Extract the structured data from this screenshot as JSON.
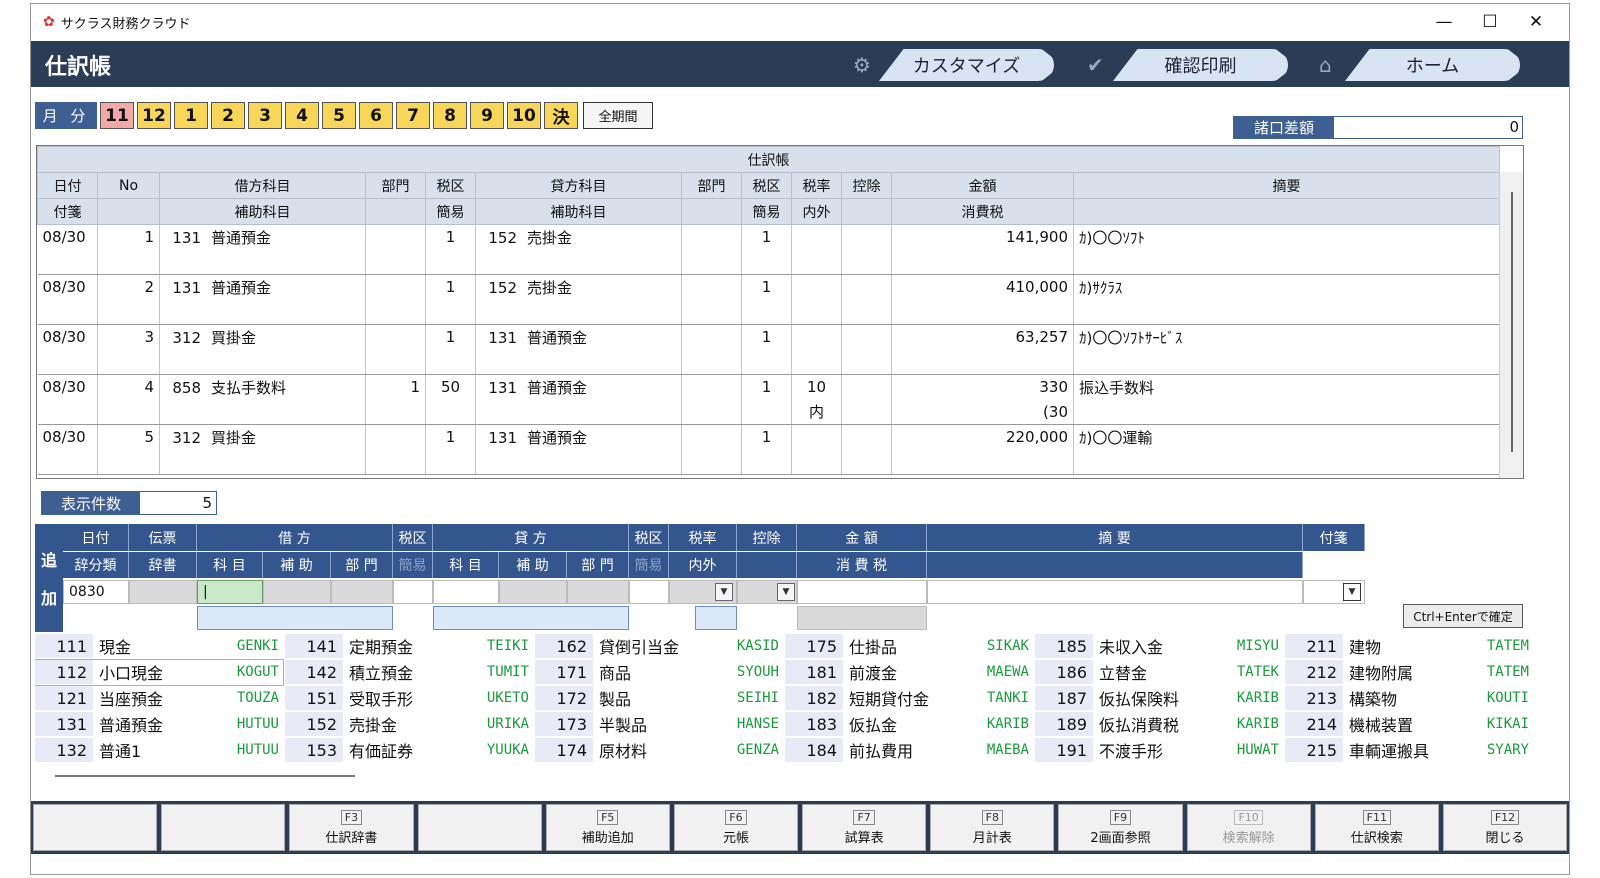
{
  "window": {
    "title": "サクラス財務クラウド",
    "min": "—",
    "max": "☐",
    "close": "✕"
  },
  "header": {
    "page_title": "仕訳帳",
    "btn_customize": "カスタマイズ",
    "btn_confirm_print": "確認印刷",
    "btn_home": "ホーム"
  },
  "months": {
    "label": "月 分",
    "items": [
      "11",
      "12",
      "1",
      "2",
      "3",
      "4",
      "5",
      "6",
      "7",
      "8",
      "9",
      "10",
      "決"
    ],
    "selected": "11",
    "all_label": "全期間"
  },
  "diff": {
    "label": "諸口差額",
    "value": "0"
  },
  "ledger": {
    "caption": "仕訳帳",
    "h1": [
      "日付",
      "No",
      "借方科目",
      "部門",
      "税区",
      "貸方科目",
      "部門",
      "税区",
      "税率",
      "控除",
      "金額",
      "摘要"
    ],
    "h2": [
      "付箋",
      "",
      "補助科目",
      "",
      "簡易",
      "補助科目",
      "",
      "簡易",
      "内外",
      "",
      "消費税",
      ""
    ],
    "rows": [
      {
        "date": "08/30",
        "no": "1",
        "dcode": "131",
        "dname": "普通預金",
        "dept": "",
        "tax": "1",
        "ccode": "152",
        "cname": "売掛金",
        "cdept": "",
        "ctax": "1",
        "rate": "",
        "inout": "",
        "deduct": "",
        "amount": "141,900",
        "ctaxamt": "",
        "memo": "ｶ)〇〇ｿﾌﾄ"
      },
      {
        "date": "08/30",
        "no": "2",
        "dcode": "131",
        "dname": "普通預金",
        "dept": "",
        "tax": "1",
        "ccode": "152",
        "cname": "売掛金",
        "cdept": "",
        "ctax": "1",
        "rate": "",
        "inout": "",
        "deduct": "",
        "amount": "410,000",
        "ctaxamt": "",
        "memo": "ｶ)ｻｸﾗｽ"
      },
      {
        "date": "08/30",
        "no": "3",
        "dcode": "312",
        "dname": "買掛金",
        "dept": "",
        "tax": "1",
        "ccode": "131",
        "cname": "普通預金",
        "cdept": "",
        "ctax": "1",
        "rate": "",
        "inout": "",
        "deduct": "",
        "amount": "63,257",
        "ctaxamt": "",
        "memo": "ｶ)〇〇ｿﾌﾄｻｰﾋﾞｽ"
      },
      {
        "date": "08/30",
        "no": "4",
        "dcode": "858",
        "dname": "支払手数料",
        "dept": "1",
        "tax": "50",
        "ccode": "131",
        "cname": "普通預金",
        "cdept": "",
        "ctax": "1",
        "rate": "10",
        "inout": "内",
        "deduct": "",
        "amount": "330",
        "ctaxamt": "(30",
        "memo": "振込手数料"
      },
      {
        "date": "08/30",
        "no": "5",
        "dcode": "312",
        "dname": "買掛金",
        "dept": "",
        "tax": "1",
        "ccode": "131",
        "cname": "普通預金",
        "cdept": "",
        "ctax": "1",
        "rate": "",
        "inout": "",
        "deduct": "",
        "amount": "220,000",
        "ctaxamt": "",
        "memo": "ｶ)〇〇運輸"
      }
    ]
  },
  "count": {
    "label": "表示件数",
    "value": "5"
  },
  "entry": {
    "add_label": [
      "追",
      "加"
    ],
    "date": "日付",
    "slip": "伝票",
    "debit": "借 方",
    "taxcat": "税区",
    "credit": "貸 方",
    "taxcat2": "税区",
    "taxrate": "税率",
    "deduct": "控除",
    "amount": "金 額",
    "memo": "摘 要",
    "tag": "付箋",
    "journal_type": "辞分類",
    "dict": "辞書",
    "subject": "科 目",
    "sub": "補 助",
    "dept": "部 門",
    "simple": "簡易",
    "subject2": "科 目",
    "sub2": "補 助",
    "dept2": "部 門",
    "simple2": "簡易",
    "inout": "内外",
    "ctax": "消 費 税",
    "date_value": "0830",
    "cursor": "|",
    "confirm": "Ctrl+Enterで確定"
  },
  "accounts": [
    [
      {
        "code": "111",
        "name": "現金",
        "kana": "GENKI"
      },
      {
        "code": "112",
        "name": "小口現金",
        "kana": "KOGUT"
      },
      {
        "code": "121",
        "name": "当座預金",
        "kana": "TOUZA"
      },
      {
        "code": "131",
        "name": "普通預金",
        "kana": "HUTUU"
      },
      {
        "code": "132",
        "name": "普通1",
        "kana": "HUTUU"
      }
    ],
    [
      {
        "code": "141",
        "name": "定期預金",
        "kana": "TEIKI"
      },
      {
        "code": "142",
        "name": "積立預金",
        "kana": "TUMIT"
      },
      {
        "code": "151",
        "name": "受取手形",
        "kana": "UKETO"
      },
      {
        "code": "152",
        "name": "売掛金",
        "kana": "URIKA"
      },
      {
        "code": "153",
        "name": "有価証券",
        "kana": "YUUKA"
      }
    ],
    [
      {
        "code": "162",
        "name": "貸倒引当金",
        "kana": "KASID"
      },
      {
        "code": "171",
        "name": "商品",
        "kana": "SYOUH"
      },
      {
        "code": "172",
        "name": "製品",
        "kana": "SEIHI"
      },
      {
        "code": "173",
        "name": "半製品",
        "kana": "HANSE"
      },
      {
        "code": "174",
        "name": "原材料",
        "kana": "GENZA"
      }
    ],
    [
      {
        "code": "175",
        "name": "仕掛品",
        "kana": "SIKAK"
      },
      {
        "code": "181",
        "name": "前渡金",
        "kana": "MAEWA"
      },
      {
        "code": "182",
        "name": "短期貸付金",
        "kana": "TANKI"
      },
      {
        "code": "183",
        "name": "仮払金",
        "kana": "KARIB"
      },
      {
        "code": "184",
        "name": "前払費用",
        "kana": "MAEBA"
      }
    ],
    [
      {
        "code": "185",
        "name": "未収入金",
        "kana": "MISYU"
      },
      {
        "code": "186",
        "name": "立替金",
        "kana": "TATEK"
      },
      {
        "code": "187",
        "name": "仮払保険料",
        "kana": "KARIB"
      },
      {
        "code": "189",
        "name": "仮払消費税",
        "kana": "KARIB"
      },
      {
        "code": "191",
        "name": "不渡手形",
        "kana": "HUWAT"
      }
    ],
    [
      {
        "code": "211",
        "name": "建物",
        "kana": "TATEM"
      },
      {
        "code": "212",
        "name": "建物附属",
        "kana": "TATEM"
      },
      {
        "code": "213",
        "name": "構築物",
        "kana": "KOUTI"
      },
      {
        "code": "214",
        "name": "機械装置",
        "kana": "KIKAI"
      },
      {
        "code": "215",
        "name": "車輌運搬具",
        "kana": "SYARY"
      }
    ]
  ],
  "fkeys": [
    {
      "code": "",
      "label": "",
      "disabled": false
    },
    {
      "code": "",
      "label": "",
      "disabled": false
    },
    {
      "code": "F3",
      "label": "仕訳辞書",
      "disabled": false
    },
    {
      "code": "",
      "label": "",
      "disabled": false
    },
    {
      "code": "F5",
      "label": "補助追加",
      "disabled": false
    },
    {
      "code": "F6",
      "label": "元帳",
      "disabled": false
    },
    {
      "code": "F7",
      "label": "試算表",
      "disabled": false
    },
    {
      "code": "F8",
      "label": "月計表",
      "disabled": false
    },
    {
      "code": "F9",
      "label": "2画面参照",
      "disabled": false
    },
    {
      "code": "F10",
      "label": "検索解除",
      "disabled": true
    },
    {
      "code": "F11",
      "label": "仕訳検索",
      "disabled": false
    },
    {
      "code": "F12",
      "label": "閉じる",
      "disabled": false
    }
  ]
}
